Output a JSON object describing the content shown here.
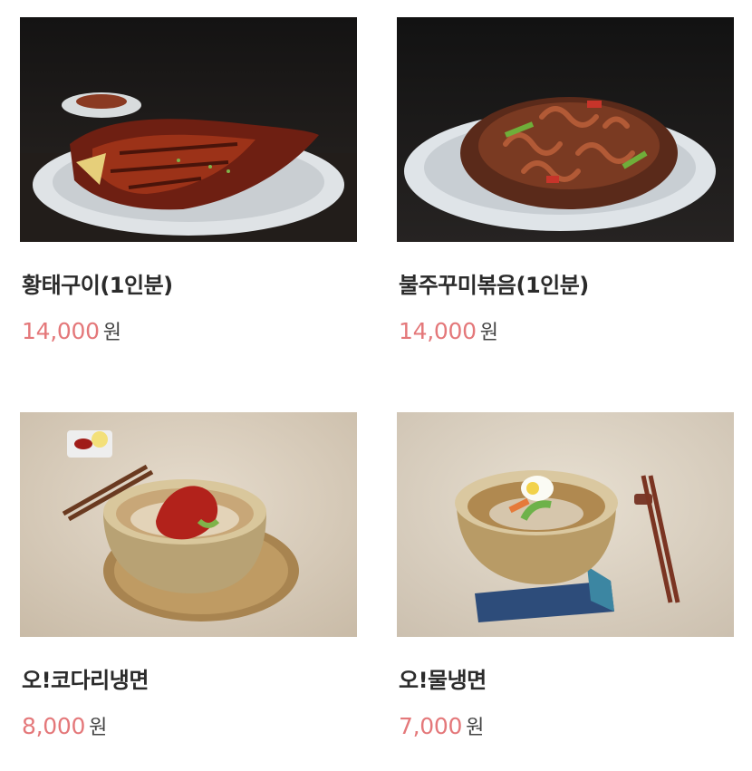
{
  "menu": {
    "items": [
      {
        "name": "황태구이(1인분)",
        "price": "14,000",
        "unit": "원",
        "image_icon": "grilled-pollock-photo"
      },
      {
        "name": "불주꾸미볶음(1인분)",
        "price": "14,000",
        "unit": "원",
        "image_icon": "stir-fried-webfoot-octopus-photo"
      },
      {
        "name": "오!코다리냉면",
        "price": "8,000",
        "unit": "원",
        "image_icon": "spicy-cold-noodles-photo"
      },
      {
        "name": "오!물냉면",
        "price": "7,000",
        "unit": "원",
        "image_icon": "cold-broth-noodles-photo"
      }
    ]
  },
  "colors": {
    "price": "#e4787a",
    "name": "#2b2b2b",
    "dark_background": "#1c1a19",
    "beige_background": "#d9cdbd"
  }
}
